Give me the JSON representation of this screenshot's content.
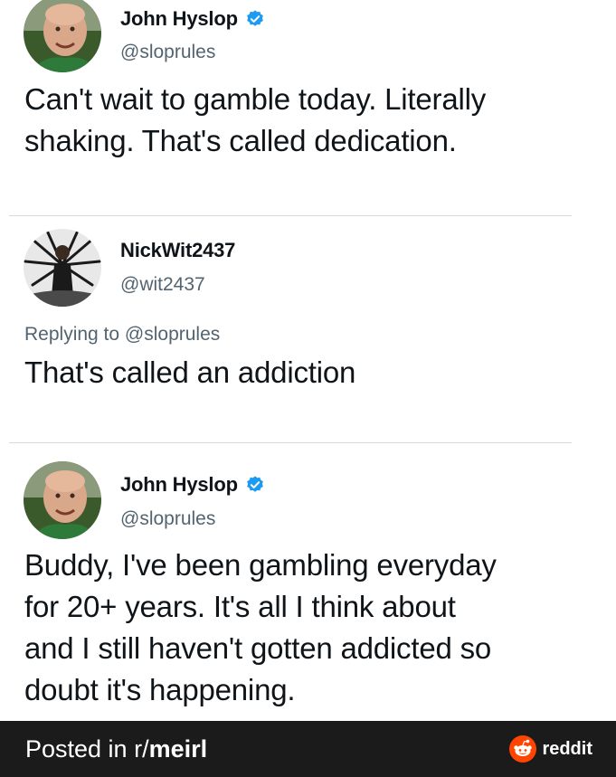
{
  "tweets": [
    {
      "display_name": "John Hyslop",
      "handle": "@sloprules",
      "verified": true,
      "replying_to": "",
      "text_lines": [
        "Can't wait to gamble today. Literally",
        "shaking. That's called dedication."
      ]
    },
    {
      "display_name": "NickWit2437",
      "handle": "@wit2437",
      "verified": false,
      "replying_label": "Replying to",
      "replying_to": "@sloprules",
      "text_lines": [
        "That's called an addiction"
      ]
    },
    {
      "display_name": "John Hyslop",
      "handle": "@sloprules",
      "verified": true,
      "replying_to": "",
      "text_lines": [
        "Buddy, I've been gambling everyday",
        "for 20+ years. It's all I think about",
        "and I still haven't gotten addicted so",
        "doubt it's happening."
      ]
    }
  ],
  "footer": {
    "prefix": "Posted in r/",
    "subreddit": "meirl",
    "brand": "reddit"
  },
  "colors": {
    "verified_blue": "#1d9bf0",
    "footer_bg": "#1b1b1b",
    "reddit_orange": "#ff4500"
  },
  "icons": {
    "verified": "verified-badge-icon",
    "reddit": "reddit-logo-icon"
  }
}
